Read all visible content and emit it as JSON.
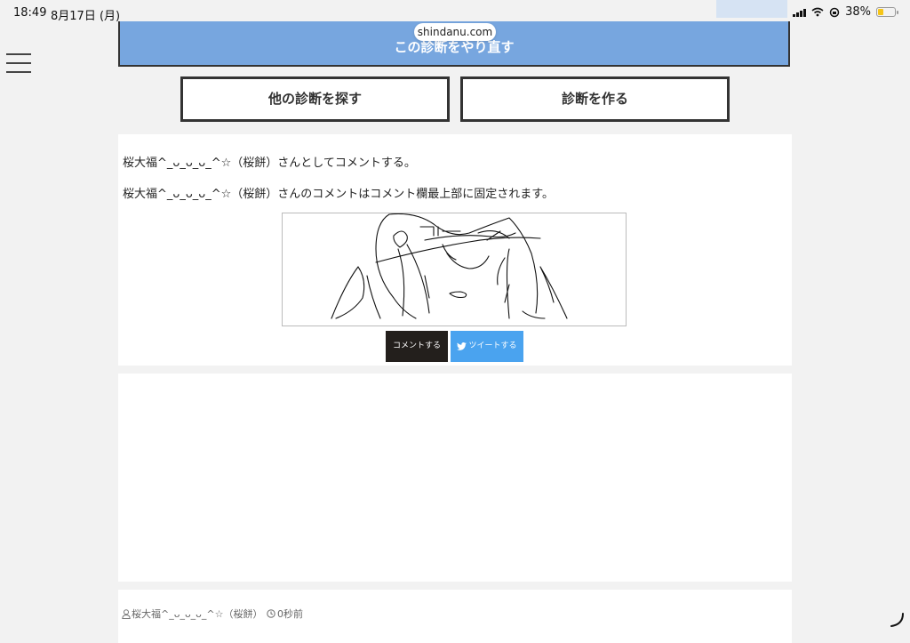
{
  "status_bar": {
    "time": "18:49",
    "date": "8月17日 (月)",
    "battery_percent": "38%",
    "battery_level": 0.38
  },
  "browser": {
    "url": "shindanu.com"
  },
  "page": {
    "retry_label": "この診断をやり直す",
    "find_other_label": "他の診断を探す",
    "create_label": "診断を作る",
    "comment_as": "桜大福^_ᴗ_ᴗ_ᴗ_^☆（桜餅）さんとしてコメントする。",
    "pinned_note": "桜大福^_ᴗ_ᴗ_ᴗ_^☆（桜餅）さんのコメントはコメント欄最上部に固定されます。",
    "comment_button": "コメントする",
    "tweet_button": "ツイートする"
  },
  "comment": {
    "author": "桜大福^_ᴗ_ᴗ_ᴗ_^☆（桜餅）",
    "time": "0秒前"
  },
  "colors": {
    "retry_bg": "#77a6df",
    "tweet_bg": "#4aa3ef",
    "comment_bg": "#231f1c"
  },
  "icons": {
    "menu": "hamburger-icon",
    "tweet": "bird-icon",
    "user": "user-icon",
    "clock": "clock-icon"
  }
}
